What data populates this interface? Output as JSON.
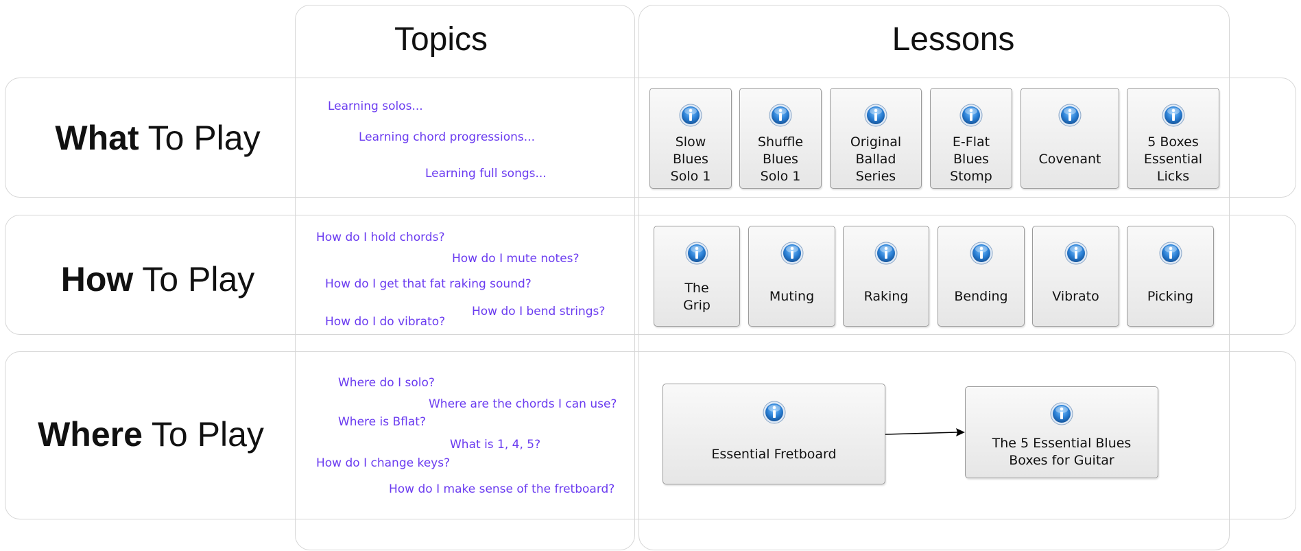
{
  "columns": {
    "topics": "Topics",
    "lessons": "Lessons"
  },
  "rows": [
    {
      "title_bold": "What",
      "title_rest": " To Play",
      "topics": [
        "Learning solos...",
        "Learning chord progressions...",
        "Learning full songs..."
      ],
      "lessons": [
        "Slow\nBlues\nSolo 1",
        "Shuffle\nBlues\nSolo 1",
        "Original\nBallad\nSeries",
        "E-Flat\nBlues\nStomp",
        "Covenant",
        "5 Boxes\nEssential\nLicks"
      ]
    },
    {
      "title_bold": "How",
      "title_rest": " To Play",
      "topics": [
        "How do I hold chords?",
        "How do I mute notes?",
        "How do I get that fat raking sound?",
        "How do I bend strings?",
        "How do I do vibrato?"
      ],
      "lessons": [
        "The\nGrip",
        "Muting",
        "Raking",
        "Bending",
        "Vibrato",
        "Picking"
      ]
    },
    {
      "title_bold": "Where",
      "title_rest": " To Play",
      "topics": [
        "Where do I solo?",
        "Where are the chords I can use?",
        "Where is Bflat?",
        "What is 1, 4, 5?",
        "How do I change keys?",
        "How do I make sense of the fretboard?"
      ],
      "lessons": [
        "Essential Fretboard",
        "The 5 Essential Blues\nBoxes for Guitar"
      ]
    }
  ],
  "colors": {
    "topic_text": "#6b3cf0",
    "info_icon": "#2a7fd4",
    "border": "#d6d6d6"
  },
  "icons": {
    "lesson_icon": "info-icon"
  }
}
